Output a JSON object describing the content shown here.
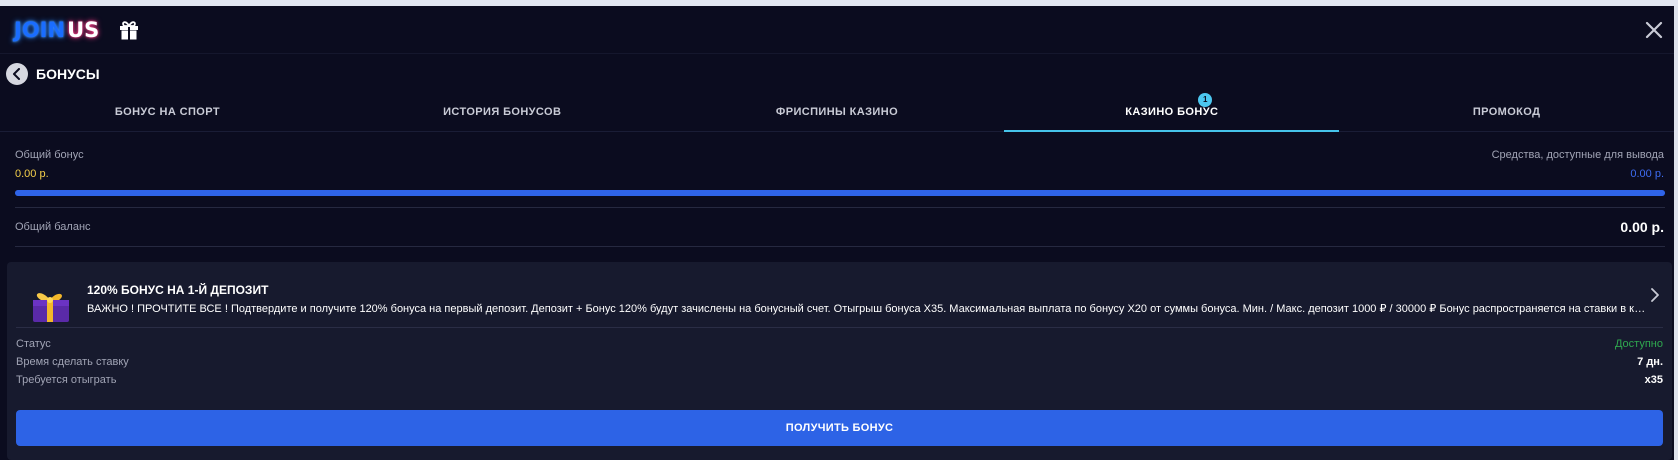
{
  "header": {
    "logo_main": "JOIN",
    "logo_accent": "US"
  },
  "page": {
    "title": "БОНУСЫ"
  },
  "tabs": [
    {
      "label": "БОНУС НА СПОРТ",
      "active": false
    },
    {
      "label": "ИСТОРИЯ БОНУСОВ",
      "active": false
    },
    {
      "label": "ФРИСПИНЫ КАЗИНО",
      "active": false
    },
    {
      "label": "КАЗИНО БОНУС",
      "active": true,
      "badge": "1"
    },
    {
      "label": "ПРОМОКОД",
      "active": false
    }
  ],
  "summary": {
    "total_bonus_label": "Общий бонус",
    "total_bonus_value": "0.00 р.",
    "withdrawable_label": "Средства, доступные для вывода",
    "withdrawable_value": "0.00 р.",
    "progress_fraction": 1.0,
    "balance_label": "Общий баланс",
    "balance_value": "0.00 р."
  },
  "bonus_card": {
    "title": "120% БОНУС НА 1-Й ДЕПОЗИТ",
    "description": "ВАЖНО ! ПРОЧТИТЕ ВСЕ ! Подтвердите и получите 120% бонуса на первый депозит. Депозит + Бонус 120% будут зачислены на бонусный счет. Отыгрыш бонуса X35. Максимальная выплата по бонусу X20 от суммы бонуса. Мин. / Макс. депозит 1000 ₽ / 30000 ₽ Бонус распространяется на ставки в казино и слотах.",
    "rows": [
      {
        "label": "Статус",
        "value": "Доступно"
      },
      {
        "label": "Время сделать ставку",
        "value": "7 дн."
      },
      {
        "label": "Требуется отыграть",
        "value": "x35"
      }
    ],
    "button_label": "ПОЛУЧИТЬ БОНУС"
  },
  "colors": {
    "background": "#0b0c1f",
    "card": "#171a2e",
    "accent_blue": "#2d63e6",
    "tab_underline": "#46c4ea",
    "bonus_yellow": "#f5d04a",
    "status_green": "#2fa84f"
  },
  "icons": {
    "header_gift": "gift-icon",
    "close": "close-icon",
    "back": "arrow-left-icon",
    "card_icon": "gift-box-icon",
    "card_chevron": "chevron-right-icon"
  }
}
